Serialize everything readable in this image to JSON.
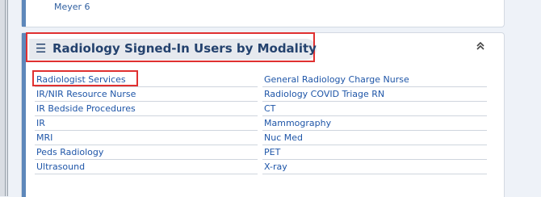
{
  "previous_widget": {
    "clipped_text": "Meyer 6"
  },
  "widget": {
    "title": "Radiology Signed-In Users by Modality",
    "menu_glyph": "☰",
    "collapse_glyph": "⌃",
    "icons": {
      "menu": "hamburger-menu-icon",
      "collapse": "double-chevron-up-icon"
    },
    "highlight_color": "#e03030",
    "accent_color": "#5d87ba",
    "link_color": "#1f56a8"
  },
  "modalities": {
    "left": [
      "Radiologist Services",
      "IR/NIR Resource Nurse",
      "IR Bedside Procedures",
      "IR",
      "MRI",
      "Peds Radiology",
      "Ultrasound"
    ],
    "right": [
      "General Radiology Charge Nurse",
      "Radiology COVID Triage RN",
      "CT",
      "Mammography",
      "Nuc Med",
      "PET",
      "X-ray"
    ]
  }
}
